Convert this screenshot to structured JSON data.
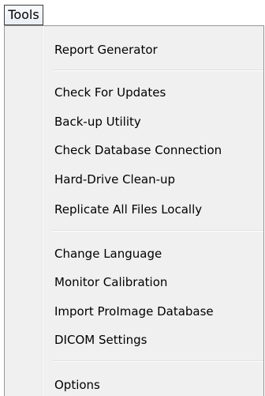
{
  "menubar": {
    "label": "Tools"
  },
  "menu": {
    "report_generator": "Report Generator",
    "check_for_updates": "Check For Updates",
    "backup_utility": "Back-up Utility",
    "check_database_connection": "Check Database Connection",
    "hard_drive_cleanup": "Hard-Drive Clean-up",
    "replicate_files": "Replicate All Files Locally",
    "change_language": "Change Language",
    "monitor_calibration": "Monitor Calibration",
    "import_proimage": "Import ProImage Database",
    "dicom_settings": "DICOM Settings",
    "options": "Options"
  }
}
